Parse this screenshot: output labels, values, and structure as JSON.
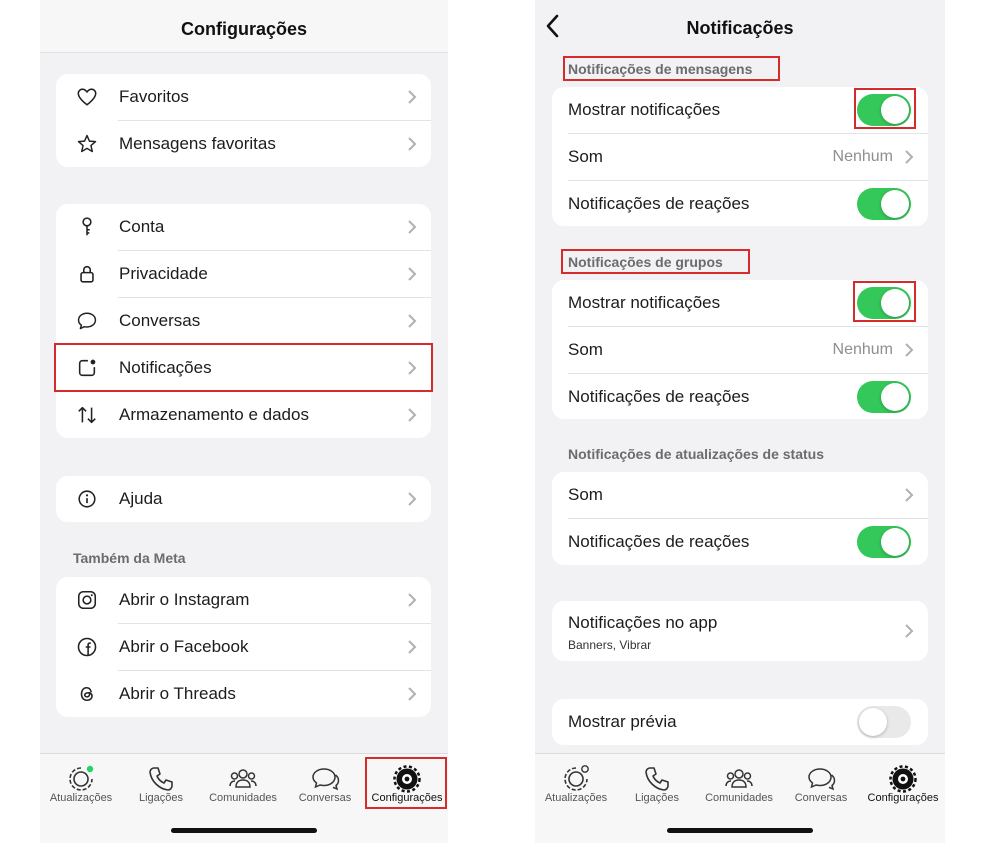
{
  "left": {
    "title": "Configurações",
    "group1": [
      {
        "label": "Favoritos",
        "icon": "heart-icon"
      },
      {
        "label": "Mensagens favoritas",
        "icon": "star-icon"
      }
    ],
    "group2": [
      {
        "label": "Conta",
        "icon": "key-icon"
      },
      {
        "label": "Privacidade",
        "icon": "lock-icon"
      },
      {
        "label": "Conversas",
        "icon": "chat-bubble-icon"
      },
      {
        "label": "Notificações",
        "icon": "notification-icon"
      },
      {
        "label": "Armazenamento e dados",
        "icon": "up-down-arrows-icon"
      }
    ],
    "group3": [
      {
        "label": "Ajuda",
        "icon": "info-icon"
      }
    ],
    "meta_section": "Também da Meta",
    "group4": [
      {
        "label": "Abrir o Instagram",
        "icon": "instagram-icon"
      },
      {
        "label": "Abrir o Facebook",
        "icon": "facebook-icon"
      },
      {
        "label": "Abrir o Threads",
        "icon": "threads-icon"
      }
    ]
  },
  "right": {
    "title": "Notificações",
    "messages": {
      "header": "Notificações de mensagens",
      "show_notifications": {
        "label": "Mostrar notificações",
        "on": true
      },
      "sound": {
        "label": "Som",
        "value": "Nenhum"
      },
      "reactions": {
        "label": "Notificações de reações",
        "on": true
      }
    },
    "groups": {
      "header": "Notificações de grupos",
      "show_notifications": {
        "label": "Mostrar notificações",
        "on": true
      },
      "sound": {
        "label": "Som",
        "value": "Nenhum"
      },
      "reactions": {
        "label": "Notificações de reações",
        "on": true
      }
    },
    "status": {
      "header": "Notificações de atualizações de status",
      "sound": {
        "label": "Som"
      },
      "reactions": {
        "label": "Notificações de reações",
        "on": true
      }
    },
    "in_app": {
      "label": "Notificações no app",
      "sublabel": "Banners, Vibrar"
    },
    "preview": {
      "label": "Mostrar prévia",
      "on": false
    }
  },
  "tabbar": {
    "tabs": [
      {
        "label": "Atualizações",
        "icon": "updates-icon"
      },
      {
        "label": "Ligações",
        "icon": "phone-icon"
      },
      {
        "label": "Comunidades",
        "icon": "communities-icon"
      },
      {
        "label": "Conversas",
        "icon": "chats-icon"
      },
      {
        "label": "Configurações",
        "icon": "settings-icon"
      }
    ]
  },
  "colors": {
    "accent_green": "#34c759",
    "highlight_red": "#d62b2b",
    "background": "#f2f2f4",
    "status_dot": "#25d366"
  }
}
